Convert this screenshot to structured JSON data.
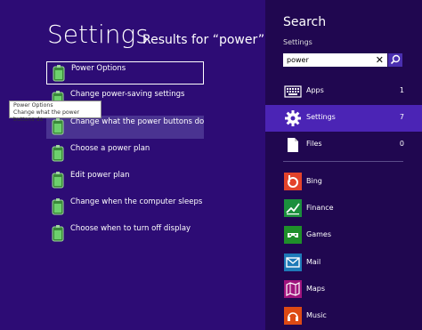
{
  "main": {
    "title": "Settings",
    "results_for": "Results for “power”",
    "results": [
      {
        "label": "Power Options"
      },
      {
        "label": "Change power-saving settings"
      },
      {
        "label": "Change what the power buttons do"
      },
      {
        "label": "Choose a power plan"
      },
      {
        "label": "Edit power plan"
      },
      {
        "label": "Change when the computer sleeps"
      },
      {
        "label": "Choose when to turn off display"
      }
    ],
    "tooltip": {
      "title": "Power Options",
      "description": "Change what the power buttons do"
    }
  },
  "search": {
    "title": "Search",
    "scope": "Settings",
    "query": "power",
    "scopes": [
      {
        "label": "Apps",
        "count": "1",
        "icon": "keyboard-icon"
      },
      {
        "label": "Settings",
        "count": "7",
        "icon": "gear-icon"
      },
      {
        "label": "Files",
        "count": "0",
        "icon": "file-icon"
      }
    ],
    "apps": [
      {
        "label": "Bing",
        "color": "#e3432b",
        "icon": "bing-icon"
      },
      {
        "label": "Finance",
        "color": "#1b8f3d",
        "icon": "finance-icon"
      },
      {
        "label": "Games",
        "color": "#1f8f2a",
        "icon": "games-icon"
      },
      {
        "label": "Mail",
        "color": "#1e7ab8",
        "icon": "mail-icon"
      },
      {
        "label": "Maps",
        "color": "#a0137d",
        "icon": "maps-icon"
      },
      {
        "label": "Music",
        "color": "#dd4a14",
        "icon": "music-icon"
      }
    ]
  }
}
